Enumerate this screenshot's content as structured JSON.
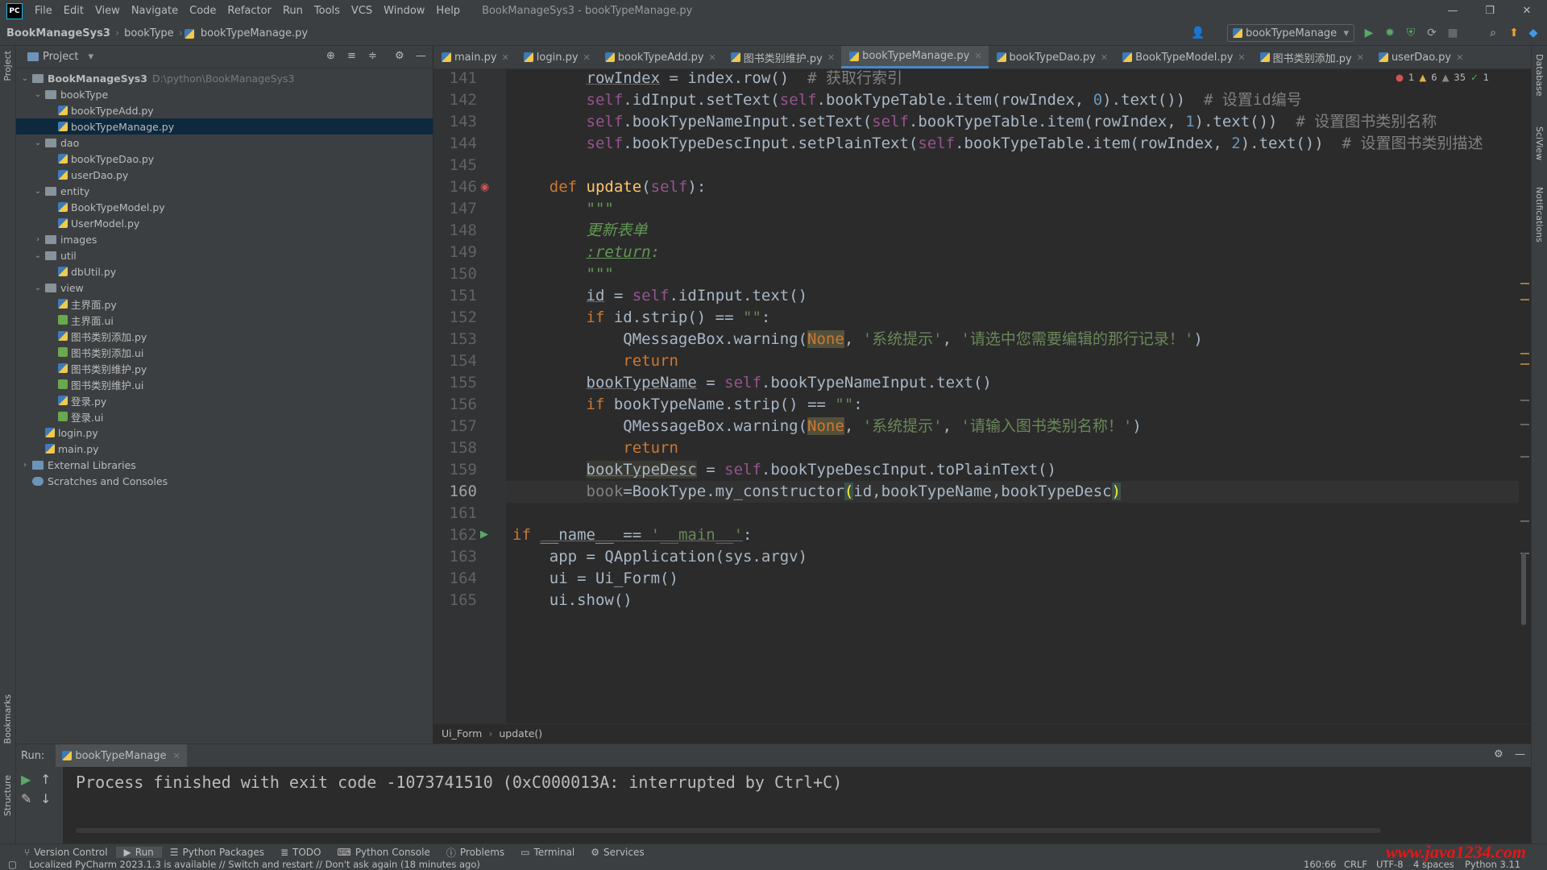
{
  "menubar": {
    "logo": "PC",
    "items": [
      "File",
      "Edit",
      "View",
      "Navigate",
      "Code",
      "Refactor",
      "Run",
      "Tools",
      "VCS",
      "Window",
      "Help"
    ],
    "window_title": "BookManageSys3 - bookTypeManage.py"
  },
  "navbar": {
    "crumbs": [
      "BookManageSys3",
      "bookType",
      "bookTypeManage.py"
    ],
    "run_config": "bookTypeManage"
  },
  "project": {
    "header": "Project",
    "tree": [
      {
        "label": "BookManageSys3",
        "path": "D:\\python\\BookManageSys3",
        "type": "folder",
        "depth": 0,
        "arrow": "open"
      },
      {
        "label": "bookType",
        "type": "folder",
        "depth": 1,
        "arrow": "open"
      },
      {
        "label": "bookTypeAdd.py",
        "type": "py",
        "depth": 2
      },
      {
        "label": "bookTypeManage.py",
        "type": "py",
        "depth": 2,
        "selected": true
      },
      {
        "label": "dao",
        "type": "folder",
        "depth": 1,
        "arrow": "open"
      },
      {
        "label": "bookTypeDao.py",
        "type": "py",
        "depth": 2
      },
      {
        "label": "userDao.py",
        "type": "py",
        "depth": 2
      },
      {
        "label": "entity",
        "type": "folder",
        "depth": 1,
        "arrow": "open"
      },
      {
        "label": "BookTypeModel.py",
        "type": "py",
        "depth": 2
      },
      {
        "label": "UserModel.py",
        "type": "py",
        "depth": 2
      },
      {
        "label": "images",
        "type": "folder",
        "depth": 1,
        "arrow": "closed"
      },
      {
        "label": "util",
        "type": "folder",
        "depth": 1,
        "arrow": "open"
      },
      {
        "label": "dbUtil.py",
        "type": "py",
        "depth": 2
      },
      {
        "label": "view",
        "type": "folder",
        "depth": 1,
        "arrow": "open"
      },
      {
        "label": "主界面.py",
        "type": "py",
        "depth": 2
      },
      {
        "label": "主界面.ui",
        "type": "ui",
        "depth": 2
      },
      {
        "label": "图书类别添加.py",
        "type": "py",
        "depth": 2
      },
      {
        "label": "图书类别添加.ui",
        "type": "ui",
        "depth": 2
      },
      {
        "label": "图书类别维护.py",
        "type": "py",
        "depth": 2
      },
      {
        "label": "图书类别维护.ui",
        "type": "ui",
        "depth": 2
      },
      {
        "label": "登录.py",
        "type": "py",
        "depth": 2
      },
      {
        "label": "登录.ui",
        "type": "ui",
        "depth": 2
      },
      {
        "label": "login.py",
        "type": "py",
        "depth": 1
      },
      {
        "label": "main.py",
        "type": "py",
        "depth": 1
      },
      {
        "label": "External Libraries",
        "type": "lib",
        "depth": 0,
        "arrow": "closed"
      },
      {
        "label": "Scratches and Consoles",
        "type": "scratch",
        "depth": 0
      }
    ]
  },
  "tabs": [
    {
      "label": "main.py"
    },
    {
      "label": "login.py"
    },
    {
      "label": "bookTypeAdd.py"
    },
    {
      "label": "图书类别维护.py"
    },
    {
      "label": "bookTypeManage.py",
      "active": true
    },
    {
      "label": "bookTypeDao.py"
    },
    {
      "label": "BookTypeModel.py"
    },
    {
      "label": "图书类别添加.py"
    },
    {
      "label": "userDao.py"
    }
  ],
  "inspections": {
    "errors": "1",
    "warnings": "6",
    "weak": "35",
    "ok": "1"
  },
  "editor": {
    "current_line": 160,
    "lines": [
      {
        "n": "141",
        "html": "        <span class='uline'>rowIndex</span> = index.row()  <span class='cmt'># 获取行索引</span>"
      },
      {
        "n": "142",
        "html": "        <span class='self'>self</span>.idInput.setText(<span class='self'>self</span>.bookTypeTable.item(rowIndex, <span class='num'>0</span>).text())  <span class='cmt'># 设置id编号</span>"
      },
      {
        "n": "143",
        "html": "        <span class='self'>self</span>.bookTypeNameInput.setText(<span class='self'>self</span>.bookTypeTable.item(rowIndex, <span class='num'>1</span>).text())  <span class='cmt'># 设置图书类别名称</span>"
      },
      {
        "n": "144",
        "html": "        <span class='self'>self</span>.bookTypeDescInput.setPlainText(<span class='self'>self</span>.bookTypeTable.item(rowIndex, <span class='num'>2</span>).text())  <span class='cmt'># 设置图书类别描述</span>"
      },
      {
        "n": "145",
        "html": ""
      },
      {
        "n": "146",
        "html": "    <span class='kw'>def</span> <span class='fn'>update</span>(<span class='self'>self</span>):"
      },
      {
        "n": "147",
        "html": "        <span class='doc'>\"\"\"</span>"
      },
      {
        "n": "148",
        "html": "        <span class='doc'>更新表单</span>"
      },
      {
        "n": "149",
        "html": "        <span class='doc'><u>:return</u>:</span>"
      },
      {
        "n": "150",
        "html": "        <span class='doc'>\"\"\"</span>"
      },
      {
        "n": "151",
        "html": "        <span class='uline'>id</span> = <span class='self'>self</span>.idInput.text()"
      },
      {
        "n": "152",
        "html": "        <span class='kw'>if</span> id.strip() == <span class='str'>\"\"</span>:"
      },
      {
        "n": "153",
        "html": "            QMessageBox.warning(<span class='hl-none'>None</span>, <span class='str'>'系统提示'</span>, <span class='str'>'请选中您需要编辑的那行记录！'</span>)"
      },
      {
        "n": "154",
        "html": "            <span class='kw'>return</span>"
      },
      {
        "n": "155",
        "html": "        <span class='uline'>bookTypeName</span> = <span class='self'>self</span>.bookTypeNameInput.text()"
      },
      {
        "n": "156",
        "html": "        <span class='kw'>if</span> bookTypeName.strip() == <span class='str'>\"\"</span>:"
      },
      {
        "n": "157",
        "html": "            QMessageBox.warning(<span class='hl-none'>None</span>, <span class='str'>'系统提示'</span>, <span class='str'>'请输入图书类别名称！'</span>)"
      },
      {
        "n": "158",
        "html": "            <span class='kw'>return</span>"
      },
      {
        "n": "159",
        "html": "        <span class='uline warnbg'>bookTypeDesc</span> = <span class='self'>self</span>.bookTypeDescInput.toPlainText()"
      },
      {
        "n": "160",
        "html": "        <span style='color:#808080'>book</span>=BookType.my_constructor<span class='brace'>(</span>id,bookTypeName,bookTypeDesc<span class='brace'>)</span>"
      },
      {
        "n": "161",
        "html": ""
      },
      {
        "n": "162",
        "html": "<span class='kw'>if</span> <span class='uline'>__name__ == </span><span class='str uline'>'__main__'</span>:"
      },
      {
        "n": "163",
        "html": "    app = QApplication(sys.argv)"
      },
      {
        "n": "164",
        "html": "    ui = Ui_Form()"
      },
      {
        "n": "165",
        "html": "    ui.show()"
      }
    ]
  },
  "editor_breadcrumb": [
    "Ui_Form",
    "update()"
  ],
  "run": {
    "label": "Run:",
    "tab": "bookTypeManage",
    "output": "Process finished with exit code -1073741510 (0xC000013A: interrupted by Ctrl+C)"
  },
  "bottom_tabs": [
    "Version Control",
    "Run",
    "Python Packages",
    "TODO",
    "Python Console",
    "Problems",
    "Terminal",
    "Services"
  ],
  "status": {
    "message": "Localized PyCharm 2023.1.3 is available // Switch and restart // Don't ask again (18 minutes ago)",
    "position": "160:66",
    "line_sep": "CRLF",
    "encoding": "UTF-8",
    "indent": "4 spaces",
    "interpreter": "Python 3.11"
  },
  "side_labels": {
    "project": "Project",
    "bookmarks": "Bookmarks",
    "structure": "Structure",
    "database": "Database",
    "sciview": "SciView",
    "notifications": "Notifications"
  },
  "watermark": "www.java1234.com"
}
